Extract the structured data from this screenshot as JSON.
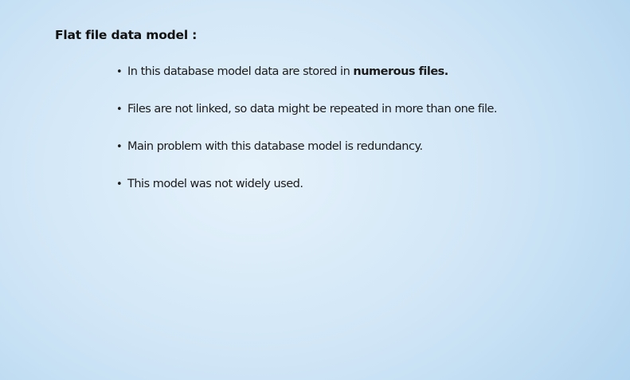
{
  "slide": {
    "title": "Flat file data model :",
    "bullet_symbol": "•",
    "bullets": [
      {
        "text": "In this database model data are stored in ",
        "emphasis": "numerous files."
      },
      {
        "text": "Files are not linked, so data might be repeated in more than one file."
      },
      {
        "text": "Main problem with this database model is redundancy."
      },
      {
        "text": "This model was not widely used."
      }
    ]
  }
}
